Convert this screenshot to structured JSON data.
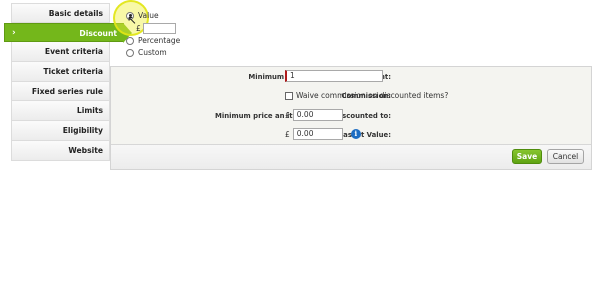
{
  "sidebar": {
    "items": [
      {
        "label": "Basic details"
      },
      {
        "label": "Discount",
        "active": true
      },
      {
        "label": "Event criteria"
      },
      {
        "label": "Ticket criteria"
      },
      {
        "label": "Fixed series rule"
      },
      {
        "label": "Limits"
      },
      {
        "label": "Eligibility"
      },
      {
        "label": "Website"
      }
    ],
    "active_chevron": "›"
  },
  "discount_type": {
    "options": [
      "Value",
      "Percentage",
      "Custom"
    ],
    "selected": "Value",
    "value_currency": "£",
    "value_amount": ""
  },
  "form": {
    "min_tickets": {
      "label": "Minimum tickets required per event:",
      "value": "1"
    },
    "commission": {
      "label": "Commission:",
      "checkbox_label": "Waive commission on discounted items?",
      "checked": false
    },
    "min_price": {
      "label": "Minimum price an item can be discounted to:",
      "currency": "£",
      "value": "0.00"
    },
    "min_basket": {
      "label": "Minimum Basket Value:",
      "currency": "£",
      "value": "0.00",
      "info_icon": "info-icon"
    }
  },
  "buttons": {
    "save": "Save",
    "cancel": "Cancel"
  },
  "colors": {
    "accent": "#74b71b",
    "required": "#b01a1a",
    "info": "#1d6dc2"
  }
}
